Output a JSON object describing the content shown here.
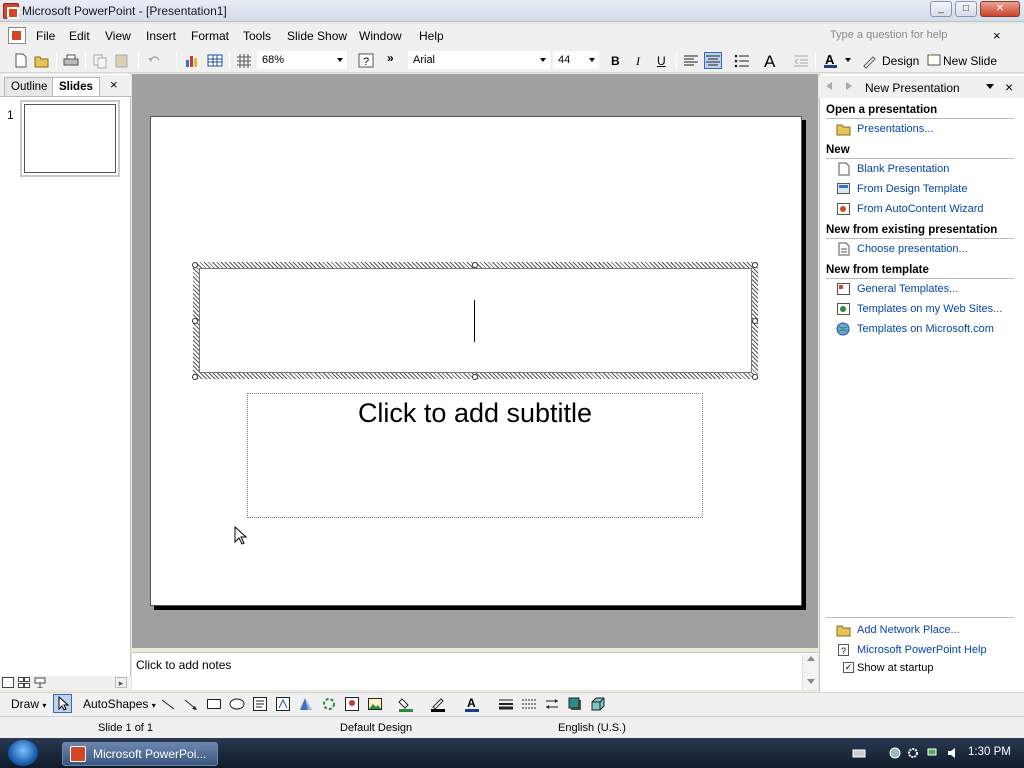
{
  "window": {
    "title": "Microsoft PowerPoint - [Presentation1]",
    "min": "_",
    "max": "□",
    "close": "✕"
  },
  "menu": {
    "items": [
      "File",
      "Edit",
      "View",
      "Insert",
      "Format",
      "Tools",
      "Slide Show",
      "Window",
      "Help"
    ],
    "help_placeholder": "Type a question for help",
    "help_close": "×"
  },
  "toolbar": {
    "zoom": "68%",
    "font": "Arial",
    "font_size": "44",
    "bold": "B",
    "italic": "I",
    "underline": "U",
    "design_label": "Design",
    "new_slide_label": "New Slide",
    "more": "»"
  },
  "left_pane": {
    "tabs": [
      "Outline",
      "Slides"
    ],
    "close": "×",
    "slide_number": "1"
  },
  "slide": {
    "subtitle_placeholder": "Click to add subtitle"
  },
  "notes": {
    "placeholder": "Click to add notes"
  },
  "task_pane": {
    "title": "New Presentation",
    "close": "×",
    "sections": [
      {
        "heading": "Open a presentation",
        "links": [
          "Presentations..."
        ]
      },
      {
        "heading": "New",
        "links": [
          "Blank Presentation",
          "From Design Template",
          "From AutoContent Wizard"
        ]
      },
      {
        "heading": "New from existing presentation",
        "links": [
          "Choose presentation..."
        ]
      },
      {
        "heading": "New from template",
        "links": [
          "General Templates...",
          "Templates on my Web Sites...",
          "Templates on Microsoft.com"
        ]
      }
    ],
    "footer_links": [
      "Add Network Place...",
      "Microsoft PowerPoint Help"
    ],
    "show_at_startup": "Show at startup",
    "show_at_startup_checked": true
  },
  "draw_toolbar": {
    "draw": "Draw",
    "autoshapes": "AutoShapes"
  },
  "status": {
    "slide": "Slide 1 of 1",
    "design": "Default Design",
    "language": "English (U.S.)"
  },
  "taskbar": {
    "app_button": "Microsoft PowerPoi...",
    "clock": "1:30 PM"
  },
  "colors": {
    "slide_bg": "#a0a0a0",
    "link": "#0645ad",
    "taskbar": "#1a2638"
  }
}
